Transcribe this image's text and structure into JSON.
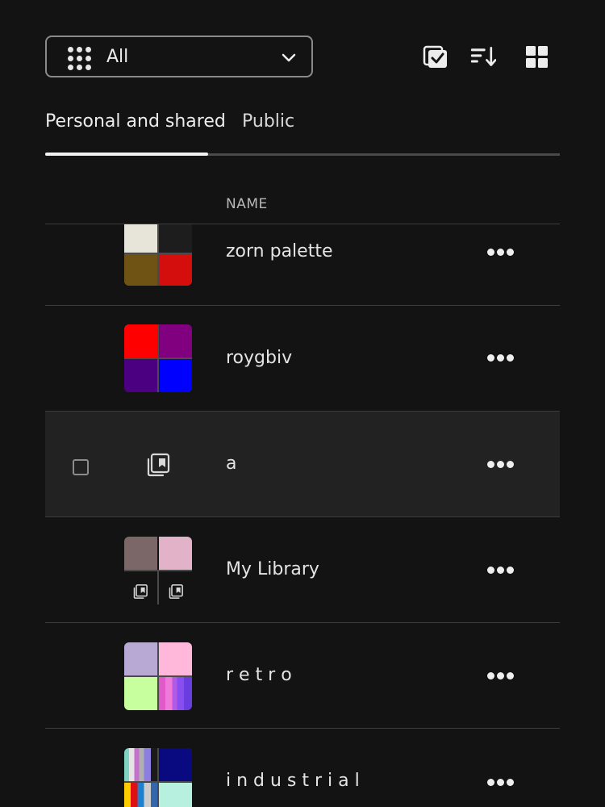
{
  "toolbar": {
    "filter_label": "All",
    "icons": [
      "grid-dots-icon",
      "chevron-down-icon",
      "select-check-icon",
      "sort-icon",
      "grid-view-icon"
    ]
  },
  "tabs": [
    {
      "label": "Personal and shared",
      "active": true
    },
    {
      "label": "Public",
      "active": false
    }
  ],
  "list": {
    "column_name": "NAME",
    "rows": [
      {
        "name": "zorn palette",
        "colors": [
          "#e7e4da",
          "#1d1d1d",
          "#6e5314",
          "#d40d0d"
        ]
      },
      {
        "name": "roygbiv",
        "colors": [
          "#ff0000",
          "#800080",
          "#4b0082",
          "#0000ff"
        ]
      },
      {
        "name": "a",
        "selected": true
      },
      {
        "name": "My Library",
        "colors": [
          "#7b6768",
          "#e2b3c8"
        ]
      },
      {
        "name": "r e t r o",
        "colors": [
          "#b8a9d4",
          "#ffb8d9",
          "#c7ff9f"
        ]
      },
      {
        "name": "i n d u s t r i a l",
        "colors": [
          "#0a0a80",
          "#b7f0de"
        ]
      }
    ]
  },
  "colors": {
    "background": "#131313",
    "selected_row": "#222222",
    "divider": "#3c3c3c",
    "text": "#e6e6e6"
  }
}
